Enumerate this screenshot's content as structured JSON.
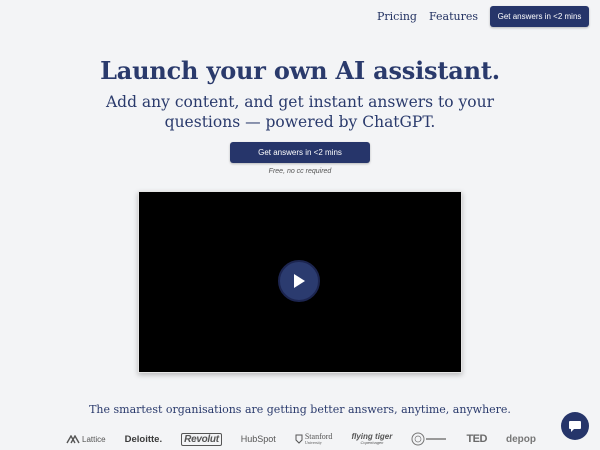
{
  "nav": {
    "pricing": "Pricing",
    "features": "Features",
    "cta": "Get answers in <2 mins"
  },
  "hero": {
    "title": "Launch your own AI assistant.",
    "subtitle": "Add any content, and get instant answers to your questions — powered by ChatGPT.",
    "cta": "Get answers in <2 mins",
    "note": "Free, no cc required"
  },
  "video": {
    "play_icon": "play-icon"
  },
  "tagline": "The smartest organisations are getting better answers, anytime, anywhere.",
  "logos": [
    "Lattice",
    "Deloitte.",
    "Revolut",
    "HubSpot",
    "Stanford",
    "University",
    "flying tiger",
    "Copenhagen",
    "TED",
    "depop"
  ],
  "chat": {
    "icon": "chat-bubble-icon"
  },
  "colors": {
    "accent": "#26356a",
    "text": "#2a3a6c",
    "background": "#f3f4f6"
  }
}
